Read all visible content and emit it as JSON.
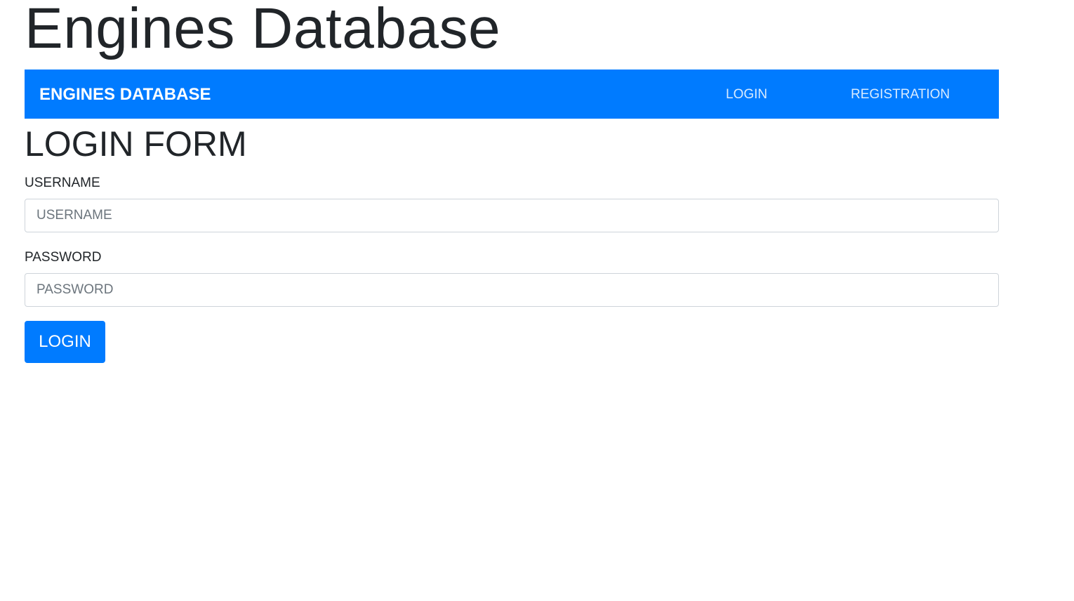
{
  "page": {
    "heading": "Engines Database"
  },
  "navbar": {
    "brand": "ENGINES DATABASE",
    "links": [
      {
        "label": "LOGIN"
      },
      {
        "label": "REGISTRATION"
      }
    ],
    "background_color": "#007bff"
  },
  "login_form": {
    "title": "LOGIN FORM",
    "username_label": "USERNAME",
    "username_placeholder": "USERNAME",
    "username_value": "",
    "password_label": "PASSWORD",
    "password_placeholder": "PASSWORD",
    "password_value": "",
    "submit_label": "LOGIN",
    "button_color": "#007bff"
  }
}
